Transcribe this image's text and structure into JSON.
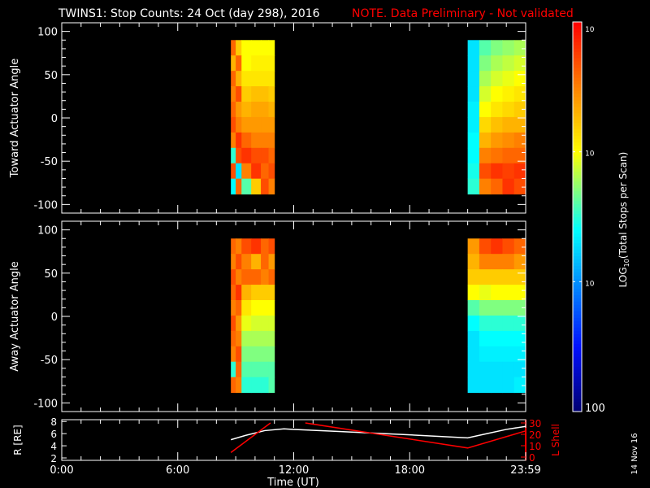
{
  "title": {
    "main": "TWINS1: Stop Counts: 24 Oct (day 298), 2016",
    "note": "NOTE. Data Preliminary - Not validated"
  },
  "colors": {
    "note": "#ff0000",
    "axis": "#ffffff",
    "lshell": "#ff0000",
    "r": "#ffffff"
  },
  "footer_date": "14 Nov 16",
  "chart_data": [
    {
      "type": "heatmap",
      "ylabel": "Toward Actuator Angle",
      "ylim": [
        -110,
        110
      ],
      "yticks": [
        "100",
        "50",
        "0",
        "-50",
        "-100"
      ],
      "ytick_values": [
        100,
        50,
        0,
        -50,
        -100
      ],
      "xlim_hours": [
        0,
        24
      ],
      "angle_range": [
        -88,
        90
      ],
      "blocks": [
        {
          "time_edges": [
            8.75,
            9.0,
            9.3,
            9.8,
            10.3,
            10.7,
            11.0
          ],
          "log10_values_rows_top_to_bottom": [
            [
              4.6,
              4.2,
              4.0,
              4.0,
              4.0,
              4.0
            ],
            [
              4.3,
              4.6,
              4.0,
              4.05,
              4.05,
              4.05
            ],
            [
              4.6,
              4.3,
              4.1,
              4.1,
              4.1,
              4.1
            ],
            [
              4.5,
              4.7,
              4.2,
              4.25,
              4.25,
              4.2
            ],
            [
              4.6,
              4.4,
              4.3,
              4.35,
              4.35,
              4.3
            ],
            [
              4.7,
              4.5,
              4.4,
              4.4,
              4.4,
              4.4
            ],
            [
              4.5,
              4.8,
              4.6,
              4.5,
              4.5,
              4.5
            ],
            [
              3.5,
              4.7,
              4.8,
              4.7,
              4.7,
              4.6
            ],
            [
              4.7,
              3.3,
              4.5,
              4.8,
              4.6,
              4.7
            ],
            [
              3.4,
              4.6,
              3.6,
              4.2,
              4.7,
              4.5
            ]
          ]
        },
        {
          "time_edges": [
            21.0,
            21.6,
            22.2,
            22.8,
            23.4,
            24.0
          ],
          "log10_values_rows_top_to_bottom": [
            [
              3.3,
              3.6,
              3.7,
              3.75,
              3.8
            ],
            [
              3.3,
              3.7,
              3.8,
              3.85,
              3.9
            ],
            [
              3.3,
              3.8,
              3.9,
              3.95,
              4.0
            ],
            [
              3.3,
              3.9,
              4.0,
              4.05,
              4.1
            ],
            [
              3.35,
              4.0,
              4.1,
              4.15,
              4.2
            ],
            [
              3.35,
              4.15,
              4.25,
              4.3,
              4.3
            ],
            [
              3.4,
              4.3,
              4.4,
              4.45,
              4.5
            ],
            [
              3.4,
              4.5,
              4.55,
              4.6,
              4.6
            ],
            [
              3.45,
              4.7,
              4.8,
              4.75,
              4.8
            ],
            [
              3.5,
              4.5,
              4.6,
              4.8,
              4.7
            ]
          ]
        }
      ]
    },
    {
      "type": "heatmap",
      "ylabel": "Away Actuator Angle",
      "ylim": [
        -110,
        110
      ],
      "yticks": [
        "100",
        "50",
        "0",
        "-50",
        "-100"
      ],
      "ytick_values": [
        100,
        50,
        0,
        -50,
        -100
      ],
      "xlim_hours": [
        0,
        24
      ],
      "angle_range": [
        -88,
        90
      ],
      "blocks": [
        {
          "time_edges": [
            8.75,
            9.0,
            9.3,
            9.8,
            10.3,
            10.7,
            11.0
          ],
          "log10_values_rows_top_to_bottom": [
            [
              4.6,
              4.5,
              4.7,
              4.8,
              4.6,
              4.7
            ],
            [
              4.5,
              4.7,
              4.5,
              4.3,
              4.6,
              4.4
            ],
            [
              4.7,
              4.5,
              4.6,
              4.6,
              4.5,
              4.6
            ],
            [
              4.6,
              4.8,
              4.3,
              4.2,
              4.2,
              4.2
            ],
            [
              4.5,
              4.6,
              4.1,
              4.0,
              4.0,
              4.0
            ],
            [
              4.7,
              4.4,
              3.95,
              3.9,
              3.9,
              3.9
            ],
            [
              4.6,
              4.5,
              3.8,
              3.8,
              3.8,
              3.8
            ],
            [
              4.5,
              4.7,
              3.7,
              3.7,
              3.7,
              3.7
            ],
            [
              3.5,
              4.6,
              3.6,
              3.6,
              3.6,
              3.6
            ],
            [
              4.6,
              4.5,
              3.5,
              3.5,
              3.5,
              3.6
            ]
          ]
        },
        {
          "time_edges": [
            21.0,
            21.6,
            22.2,
            22.8,
            23.4,
            24.0
          ],
          "log10_values_rows_top_to_bottom": [
            [
              4.4,
              4.7,
              4.8,
              4.7,
              4.6
            ],
            [
              4.3,
              4.5,
              4.5,
              4.5,
              4.4
            ],
            [
              4.2,
              4.2,
              4.2,
              4.2,
              4.2
            ],
            [
              4.0,
              3.95,
              4.0,
              4.0,
              4.0
            ],
            [
              3.6,
              3.7,
              3.7,
              3.7,
              3.7
            ],
            [
              3.4,
              3.5,
              3.5,
              3.5,
              3.5
            ],
            [
              3.3,
              3.4,
              3.4,
              3.4,
              3.4
            ],
            [
              3.3,
              3.35,
              3.35,
              3.35,
              3.35
            ],
            [
              3.3,
              3.3,
              3.3,
              3.3,
              3.3
            ],
            [
              3.3,
              3.3,
              3.3,
              3.3,
              3.35
            ]
          ]
        }
      ]
    },
    {
      "type": "line",
      "xlabel": "Time (UT)",
      "xticks": [
        "0:00",
        "6:00",
        "12:00",
        "18:00",
        "23:59"
      ],
      "xtick_hours": [
        0,
        6,
        12,
        18,
        24
      ],
      "ylabel": "R [RE]",
      "ylim": [
        2,
        8
      ],
      "yticks": [
        "8",
        "6",
        "4",
        "2"
      ],
      "ytick_values": [
        8,
        6,
        4,
        2
      ],
      "y2label": "L Shell",
      "y2lim": [
        0,
        30
      ],
      "y2ticks": [
        "30",
        "20",
        "10",
        "0"
      ],
      "y2tick_values": [
        30,
        20,
        10,
        0
      ],
      "series": [
        {
          "name": "R",
          "axis": "left",
          "x_hours": [
            8.75,
            9.5,
            10.5,
            11.5,
            12.0,
            14.0,
            16.0,
            18.0,
            21.0,
            22.0,
            23.0,
            24.0
          ],
          "values": [
            5.0,
            5.7,
            6.5,
            6.8,
            6.7,
            6.4,
            6.1,
            5.8,
            5.3,
            6.0,
            6.7,
            7.2
          ]
        },
        {
          "name": "L Shell",
          "axis": "right",
          "segments": [
            {
              "x_hours": [
                8.75,
                10.8
              ],
              "values": [
                4,
                30
              ]
            },
            {
              "x_hours": [
                12.6,
                21.0,
                24.0
              ],
              "values": [
                30,
                8,
                23
              ]
            }
          ]
        }
      ]
    },
    {
      "type": "colorbar",
      "label_main": "LOG",
      "label_sub": "10",
      "label_rest": "(Total Stops per Scan)",
      "range_log10": [
        2,
        5
      ],
      "ticks": [
        {
          "base": "10",
          "exp": "5",
          "log10": 5
        },
        {
          "base": "10",
          "exp": "4",
          "log10": 4
        },
        {
          "base": "10",
          "exp": "3",
          "log10": 3
        },
        {
          "base": "100",
          "exp": "",
          "log10": 2
        }
      ]
    }
  ]
}
